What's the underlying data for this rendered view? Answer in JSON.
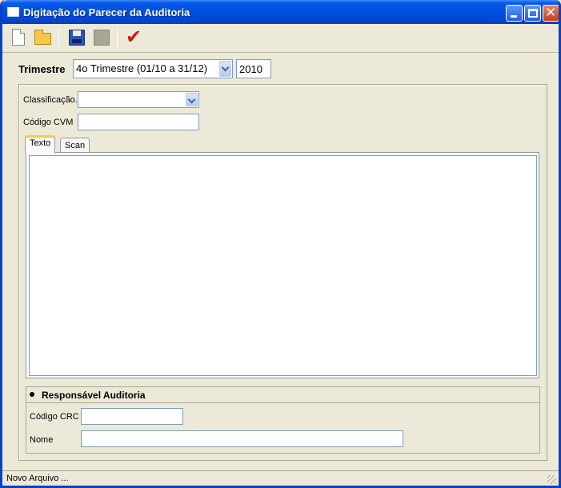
{
  "window": {
    "title": "Digitação do Parecer da Auditoria",
    "title_icon": "window-icon",
    "controls": [
      "minimize-icon",
      "maximize-icon",
      "close-icon"
    ],
    "accent_color": "#0050e0"
  },
  "toolbar": {
    "items": [
      {
        "name": "new-file",
        "icon": "new-document-icon"
      },
      {
        "name": "open-file",
        "icon": "open-folder-icon"
      },
      {
        "name": "save",
        "icon": "save-disk-icon"
      },
      {
        "name": "save-disabled",
        "icon": "disabled-disk-icon"
      },
      {
        "name": "confirm",
        "icon": "checkmark-icon"
      }
    ],
    "checkmark_color": "#cc1a12"
  },
  "filter": {
    "trimestre_label": "Trimestre",
    "trimestre_value": "4o Trimestre (01/10 a 31/12)",
    "year_value": "2010"
  },
  "form": {
    "classificacao_label": "Classificação.",
    "classificacao_value": "",
    "codigo_cvm_label": "Código CVM",
    "codigo_cvm_value": ""
  },
  "tabs": [
    {
      "label": "Texto",
      "active": true
    },
    {
      "label": "Scan",
      "active": false
    }
  ],
  "texto": {
    "content": ""
  },
  "responsavel": {
    "title": "Responsável Auditoria",
    "codigo_crc_label": "Código CRC",
    "codigo_crc_value": "",
    "nome_label": "Nome",
    "nome_value": ""
  },
  "status": {
    "text": "Novo Arquivo ..."
  }
}
